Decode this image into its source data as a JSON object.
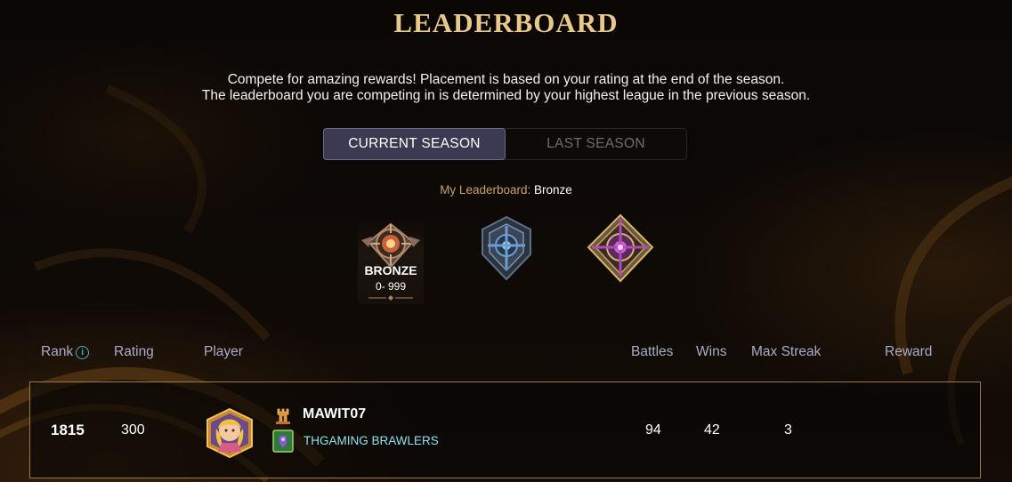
{
  "header": {
    "title": "LEADERBOARD",
    "subtitle_line1": "Compete for amazing rewards! Placement is based on your rating at the end of the season.",
    "subtitle_line2": "The leaderboard you are competing in is determined by your highest league in the previous season."
  },
  "tabs": [
    {
      "label": "CURRENT SEASON",
      "active": true
    },
    {
      "label": "LAST SEASON",
      "active": false
    }
  ],
  "my_leaderboard": {
    "label": "My Leaderboard:",
    "value": "Bronze"
  },
  "leagues": [
    {
      "name": "BRONZE",
      "range": "0- 999",
      "selected": true,
      "icon": "bronze-league-icon",
      "color": "#c8774a"
    },
    {
      "name": "",
      "range": "",
      "selected": false,
      "icon": "silver-league-icon",
      "color": "#6f9ccf"
    },
    {
      "name": "",
      "range": "",
      "selected": false,
      "icon": "gold-league-icon",
      "color": "#b04bb8"
    }
  ],
  "table": {
    "columns": {
      "rank": "Rank",
      "rating": "Rating",
      "player": "Player",
      "battles": "Battles",
      "wins": "Wins",
      "max_streak": "Max Streak",
      "reward": "Reward"
    },
    "rows": [
      {
        "rank": "1815",
        "rating": "300",
        "player_name": "MAWIT07",
        "guild_name": "THGAMING BRAWLERS",
        "battles": "94",
        "wins": "42",
        "max_streak": "3",
        "reward": ""
      }
    ]
  },
  "colors": {
    "title": "#e8c98b",
    "accent_tab": "#3b3a52",
    "row_border": "#9c7a45",
    "guild": "#8fe3ef",
    "header_text": "#a9adc6",
    "info": "#3fb3c4"
  }
}
